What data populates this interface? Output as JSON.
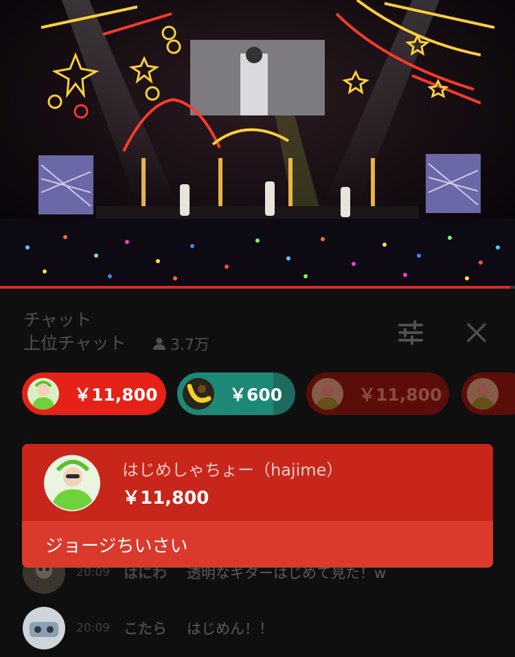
{
  "video": {
    "progress": 0.99
  },
  "chat": {
    "title": "チャット",
    "mode": "上位チャット",
    "viewers": "3.7万",
    "icons": {
      "viewers": "person-icon",
      "filter": "tune-icon",
      "close": "close-icon"
    }
  },
  "ticker": [
    {
      "amount": "￥11,800",
      "color": "#e62117",
      "avatar": "green-costume-avatar"
    },
    {
      "amount": "￥600",
      "color": "#1d6b5e",
      "avatar": "banana-avatar"
    },
    {
      "amount": "￥11,800",
      "color": "#5b0d09",
      "avatar": "green-costume-avatar"
    },
    {
      "amount": "",
      "color": "#5b0d09",
      "avatar": "green-costume-avatar"
    }
  ],
  "pinned": {
    "name": "はじめしゃちょー（hajime）",
    "amount": "￥11,800",
    "message": "ジョージちいさい",
    "header_color": "#c8261a",
    "body_color": "#da3a2b"
  },
  "messages": [
    {
      "time": "20:09",
      "author": "はにわ",
      "text": "透明なギターはじめて見た！w"
    },
    {
      "time": "20:09",
      "author": "こたら",
      "text": "はじめん！！"
    }
  ]
}
